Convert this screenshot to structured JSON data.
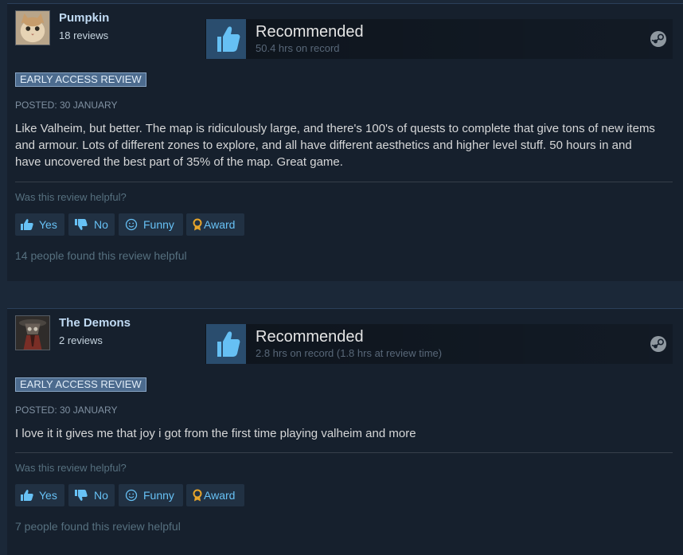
{
  "reviews": [
    {
      "author": "Pumpkin",
      "author_review_count": "18 reviews",
      "avatar": "cat-avatar",
      "verdict": "Recommended",
      "hours": "50.4 hrs on record",
      "badge": "EARLY ACCESS REVIEW",
      "posted": "POSTED: 30 JANUARY",
      "text": "Like Valheim, but better. The map is ridiculously large, and there's 100's of quests to complete that give tons of new items and armour. Lots of different zones to explore, and all have different aesthetics and higher level stuff. 50 hours in and have uncovered the best part of 35% of the map. Great game.",
      "helpful_question": "Was this review helpful?",
      "buttons": {
        "yes": "Yes",
        "no": "No",
        "funny": "Funny",
        "award": "Award"
      },
      "found_helpful": "14 people found this review helpful"
    },
    {
      "author": "The Demons",
      "author_review_count": "2 reviews",
      "avatar": "hooded-figure-avatar",
      "verdict": "Recommended",
      "hours": "2.8 hrs on record (1.8 hrs at review time)",
      "badge": "EARLY ACCESS REVIEW",
      "posted": "POSTED: 30 JANUARY",
      "text": "I love it it gives me that joy i got from the first time playing valheim and more",
      "helpful_question": "Was this review helpful?",
      "buttons": {
        "yes": "Yes",
        "no": "No",
        "funny": "Funny",
        "award": "Award"
      },
      "found_helpful": "7 people found this review helpful"
    }
  ],
  "colors": {
    "page_bg": "#1b2838",
    "card_bg": "#16202d",
    "link": "#67c1f5",
    "author": "#c1dbf4",
    "badge_bg": "#4c6b8e",
    "award_gold": "#e8a52a"
  },
  "icons": [
    "thumbs-up-icon",
    "steam-logo-icon",
    "thumbs-down-icon",
    "smiley-icon",
    "award-ribbon-icon"
  ]
}
